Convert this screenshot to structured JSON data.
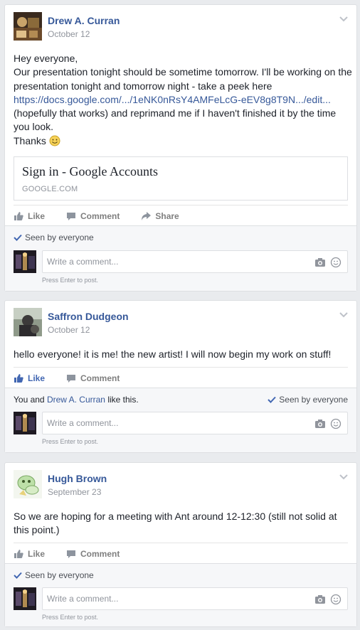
{
  "posts": [
    {
      "author": "Drew A. Curran",
      "date": "October 12",
      "text_lines": [
        "Hey everyone,",
        "Our presentation tonight should be sometime tomorrow. I'll be working on the",
        "presentation tonight and tomorrow night - take a peek here"
      ],
      "link_text": "https://docs.google.com/.../1eNK0nRsY4AMFeLcG-eEV8g8T9N.../edit...",
      "text_after": [
        "(hopefully that works) and reprimand me if I haven't finished it by the time",
        "you look.",
        "Thanks"
      ],
      "preview": {
        "title": "Sign in - Google Accounts",
        "domain": "GOOGLE.COM"
      },
      "actions": {
        "like": "Like",
        "comment": "Comment",
        "share": "Share"
      },
      "seen": "Seen by everyone",
      "comment_placeholder": "Write a comment...",
      "hint": "Press Enter to post."
    },
    {
      "author": "Saffron Dudgeon",
      "date": "October 12",
      "text": "hello everyone! it is me! the new artist! I will now begin my work on stuff!",
      "actions": {
        "like": "Like",
        "comment": "Comment"
      },
      "likes": {
        "prefix": "You and ",
        "name": "Drew A. Curran",
        "suffix": " like this."
      },
      "seen": "Seen by everyone",
      "comment_placeholder": "Write a comment...",
      "hint": "Press Enter to post."
    },
    {
      "author": "Hugh Brown",
      "date": "September 23",
      "text_lines": [
        "So we are hoping for a meeting with Ant around 12-12:30 (still not solid at",
        "this point.)"
      ],
      "actions": {
        "like": "Like",
        "comment": "Comment"
      },
      "seen": "Seen by everyone",
      "comment_placeholder": "Write a comment...",
      "hint": "Press Enter to post."
    }
  ],
  "colors": {
    "link": "#365899",
    "liked": "#4267b2",
    "meta": "#90949c"
  },
  "icons": [
    "chevron-down-icon",
    "like-icon",
    "comment-icon",
    "share-icon",
    "checkmark-icon",
    "camera-icon",
    "emoji-icon",
    "smiley-icon"
  ]
}
